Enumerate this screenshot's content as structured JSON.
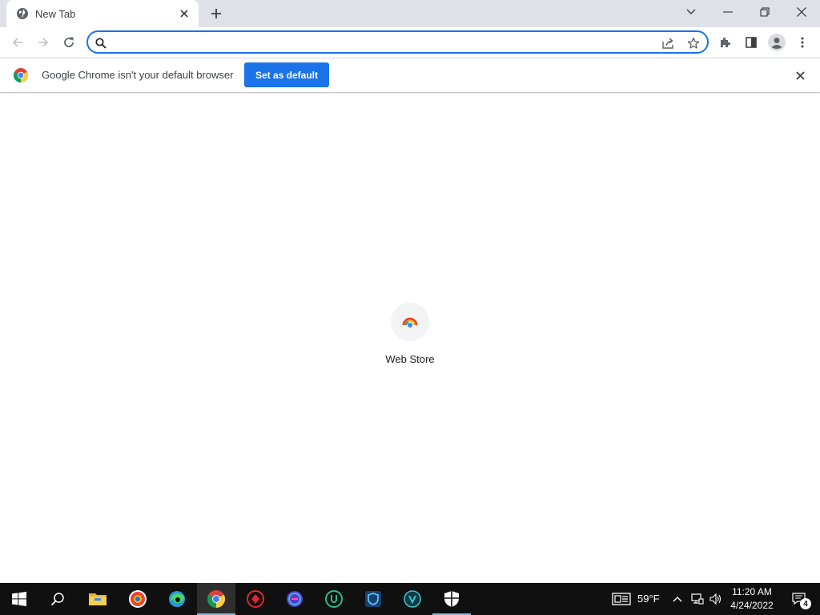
{
  "tab": {
    "title": "New Tab"
  },
  "omnibox": {
    "value": "",
    "placeholder": ""
  },
  "infobar": {
    "message": "Google Chrome isn't your default browser",
    "button_label": "Set as default"
  },
  "shortcuts": [
    {
      "label": "Web Store",
      "icon": "webstore-icon"
    }
  ],
  "taskbar": {
    "apps": [
      "start-icon",
      "search-icon",
      "file-explorer-icon",
      "brave-icon",
      "edge-icon",
      "chrome-icon",
      "app-red-icon",
      "app-purple-icon",
      "app-u-icon",
      "app-shield-icon",
      "app-v-icon",
      "security-icon"
    ],
    "weather": "59°F",
    "time": "11:20 AM",
    "date": "4/24/2022",
    "notifications": "4"
  },
  "colors": {
    "accent": "#1a73e8",
    "tabstrip": "#dee1e6",
    "taskbar": "#101010"
  }
}
